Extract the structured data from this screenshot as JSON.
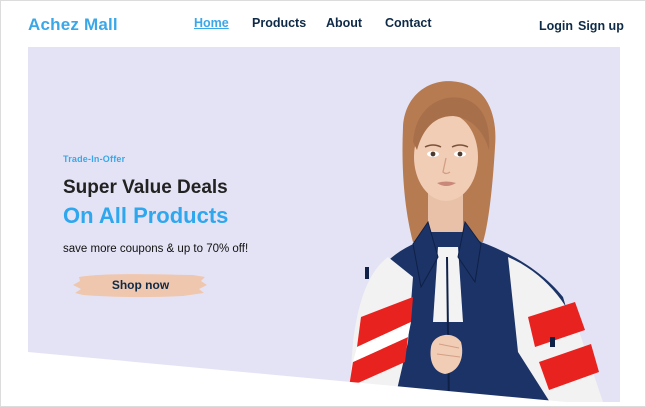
{
  "header": {
    "logo": "Achez Mall",
    "nav": [
      {
        "label": "Home",
        "active": true
      },
      {
        "label": "Products",
        "active": false
      },
      {
        "label": "About",
        "active": false
      },
      {
        "label": "Contact",
        "active": false
      }
    ],
    "login": "Login",
    "signup": "Sign up"
  },
  "hero": {
    "tag": "Trade-In-Offer",
    "headline": "Super Value Deals",
    "highlight": "On All Products",
    "subtitle": "save more coupons & up to 70% off!",
    "cta": "Shop now"
  },
  "colors": {
    "accent": "#3aa7e8",
    "navy": "#0e2a47",
    "hero_bg": "#e4e3f5",
    "cta_brush": "#efc7ae"
  }
}
